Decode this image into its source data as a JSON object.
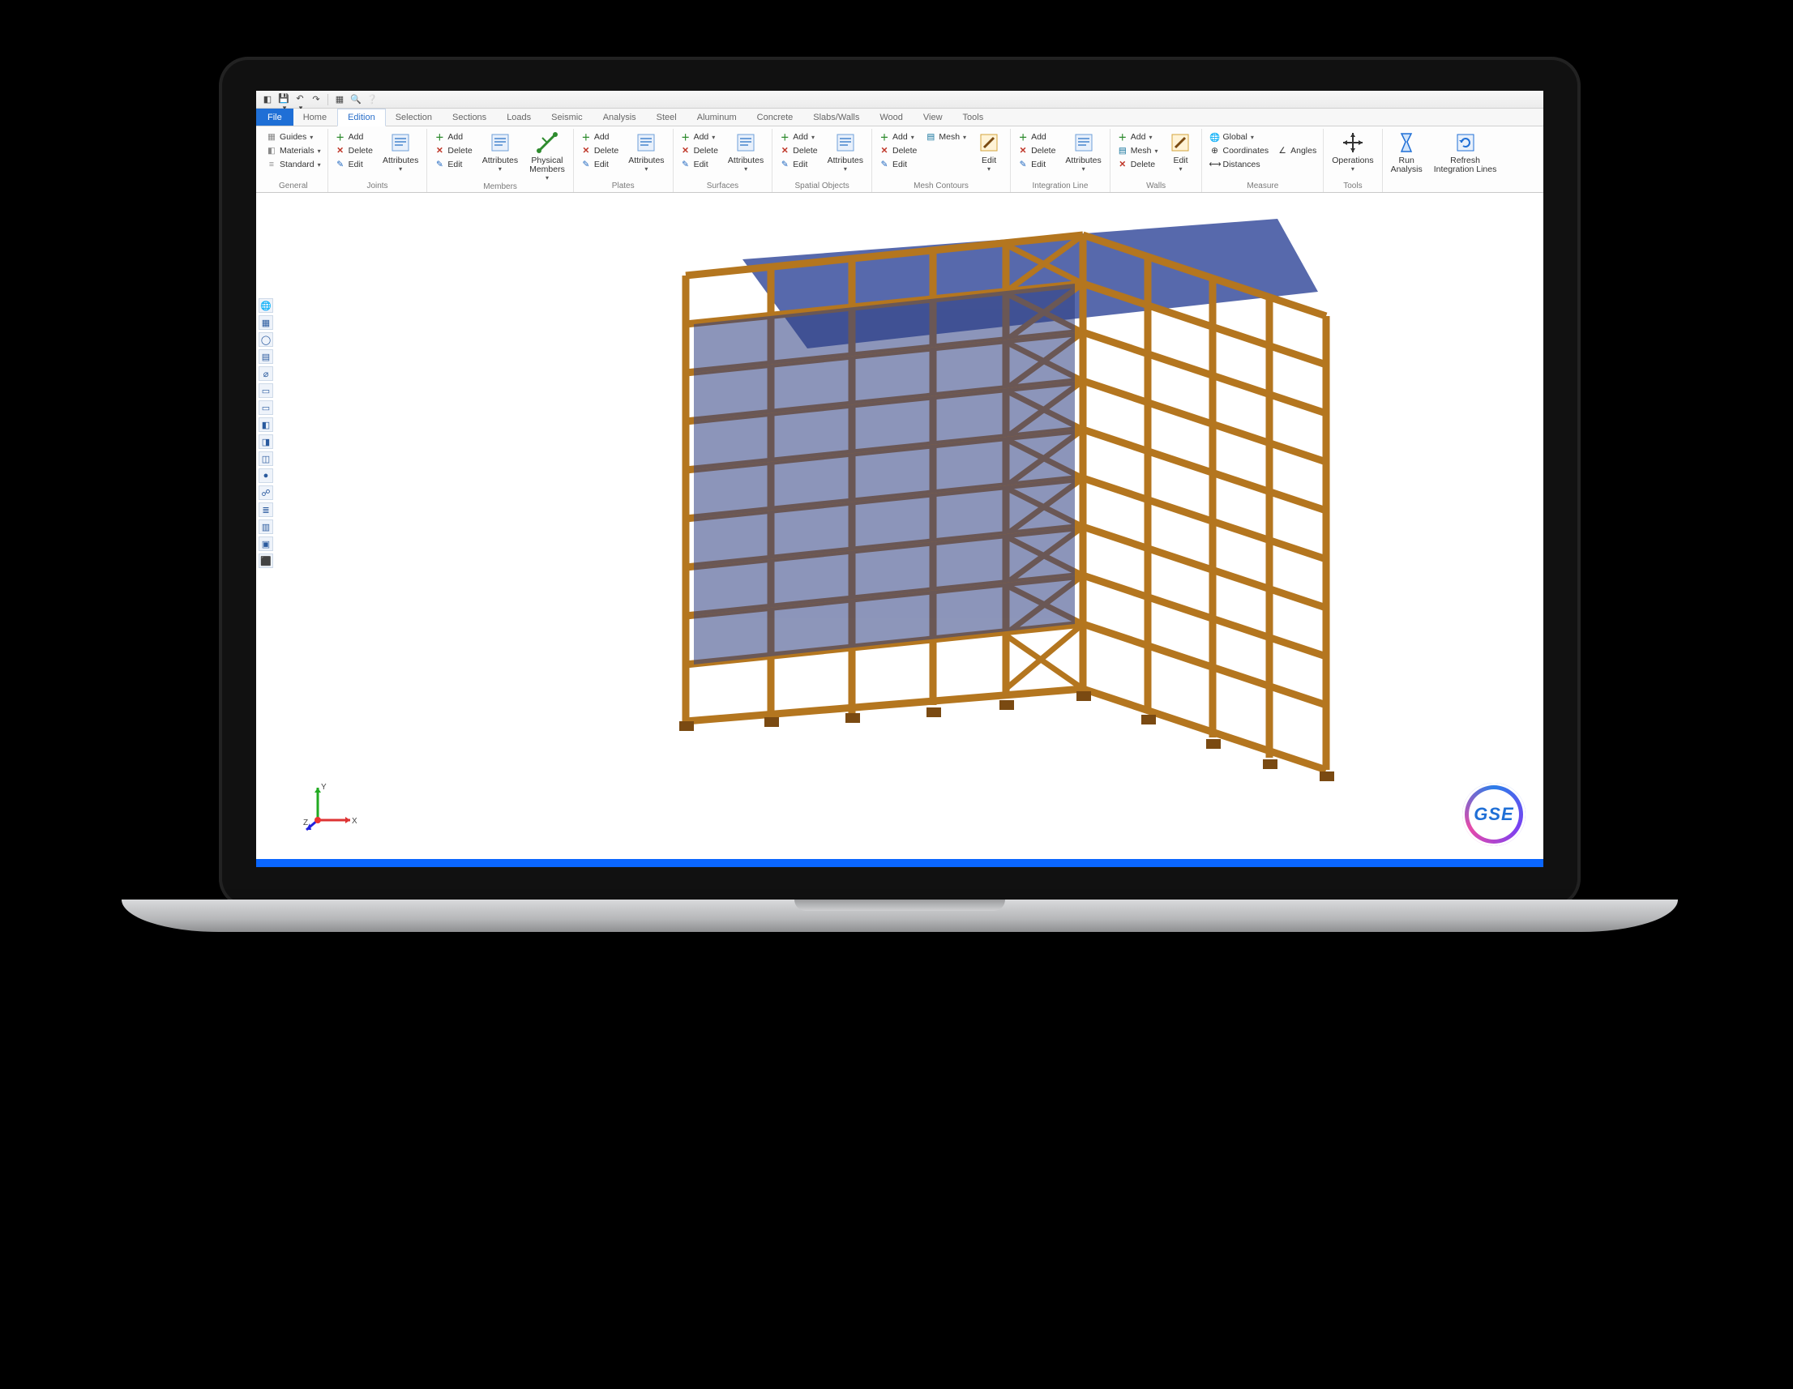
{
  "app": {
    "name": "GSE",
    "logo_text": "GSE"
  },
  "qat": {
    "items": [
      "save",
      "undo",
      "redo",
      "sep",
      "grid",
      "find",
      "help"
    ]
  },
  "tabs": {
    "file": "File",
    "list": [
      "Home",
      "Edition",
      "Selection",
      "Sections",
      "Loads",
      "Seismic",
      "Analysis",
      "Steel",
      "Aluminum",
      "Concrete",
      "Slabs/Walls",
      "Wood",
      "View",
      "Tools"
    ],
    "active_index": 1
  },
  "ribbon": {
    "groups": [
      {
        "name": "General",
        "columns": [
          {
            "buttons": [
              {
                "icon": "grid",
                "label": "Guides",
                "dropdown": true
              },
              {
                "icon": "mat",
                "label": "Materials",
                "dropdown": true
              },
              {
                "icon": "std",
                "label": "Standard",
                "dropdown": true
              }
            ]
          }
        ]
      },
      {
        "name": "Joints",
        "columns": [
          {
            "buttons": [
              {
                "icon": "add",
                "label": "Add"
              },
              {
                "icon": "del",
                "label": "Delete"
              },
              {
                "icon": "edit",
                "label": "Edit"
              }
            ]
          },
          {
            "big": {
              "icon": "attr",
              "label": "Attributes",
              "dropdown": true
            }
          }
        ]
      },
      {
        "name": "Members",
        "columns": [
          {
            "buttons": [
              {
                "icon": "add",
                "label": "Add"
              },
              {
                "icon": "del",
                "label": "Delete"
              },
              {
                "icon": "edit",
                "label": "Edit"
              }
            ]
          },
          {
            "big": {
              "icon": "attr",
              "label": "Attributes",
              "dropdown": true
            }
          },
          {
            "big": {
              "icon": "phys",
              "label": "Physical\nMembers",
              "dropdown": true
            }
          }
        ]
      },
      {
        "name": "Plates",
        "columns": [
          {
            "buttons": [
              {
                "icon": "add",
                "label": "Add"
              },
              {
                "icon": "del",
                "label": "Delete"
              },
              {
                "icon": "edit",
                "label": "Edit"
              }
            ]
          },
          {
            "big": {
              "icon": "attr",
              "label": "Attributes",
              "dropdown": true
            }
          }
        ]
      },
      {
        "name": "Surfaces",
        "columns": [
          {
            "buttons": [
              {
                "icon": "add",
                "label": "Add",
                "dropdown": true
              },
              {
                "icon": "del",
                "label": "Delete"
              },
              {
                "icon": "edit",
                "label": "Edit"
              }
            ]
          },
          {
            "big": {
              "icon": "attr",
              "label": "Attributes",
              "dropdown": true
            }
          }
        ]
      },
      {
        "name": "Spatial Objects",
        "columns": [
          {
            "buttons": [
              {
                "icon": "add",
                "label": "Add",
                "dropdown": true
              },
              {
                "icon": "del",
                "label": "Delete"
              },
              {
                "icon": "edit",
                "label": "Edit"
              }
            ]
          },
          {
            "big": {
              "icon": "attr",
              "label": "Attributes",
              "dropdown": true
            }
          }
        ]
      },
      {
        "name": "Mesh Contours",
        "columns": [
          {
            "buttons": [
              {
                "icon": "add",
                "label": "Add",
                "dropdown": true
              },
              {
                "icon": "del",
                "label": "Delete"
              },
              {
                "icon": "edit",
                "label": "Edit"
              }
            ]
          },
          {
            "buttons": [
              {
                "icon": "mesh",
                "label": "Mesh",
                "dropdown": true
              }
            ]
          },
          {
            "big": {
              "icon": "editbig",
              "label": "Edit",
              "dropdown": true
            }
          }
        ]
      },
      {
        "name": "Integration Line",
        "columns": [
          {
            "buttons": [
              {
                "icon": "add",
                "label": "Add"
              },
              {
                "icon": "del",
                "label": "Delete"
              },
              {
                "icon": "edit",
                "label": "Edit"
              }
            ]
          },
          {
            "big": {
              "icon": "attr",
              "label": "Attributes",
              "dropdown": true
            }
          }
        ]
      },
      {
        "name": "Walls",
        "columns": [
          {
            "buttons": [
              {
                "icon": "add",
                "label": "Add",
                "dropdown": true
              },
              {
                "icon": "mesh",
                "label": "Mesh",
                "dropdown": true
              },
              {
                "icon": "del",
                "label": "Delete"
              }
            ]
          },
          {
            "big": {
              "icon": "editbig",
              "label": "Edit",
              "dropdown": true
            }
          }
        ]
      },
      {
        "name": "Measure",
        "columns": [
          {
            "buttons": [
              {
                "icon": "globe",
                "label": "Global",
                "dropdown": true
              },
              {
                "icon": "coord",
                "label": "Coordinates"
              },
              {
                "icon": "dist",
                "label": "Distances"
              }
            ]
          },
          {
            "buttons": [
              {
                "icon": "blank",
                "label": ""
              },
              {
                "icon": "angle",
                "label": "Angles"
              },
              {
                "icon": "blank",
                "label": ""
              }
            ]
          }
        ]
      },
      {
        "name": "Tools",
        "columns": [
          {
            "big": {
              "icon": "ops",
              "label": "Operations",
              "dropdown": true
            }
          }
        ]
      },
      {
        "name": "",
        "columns": [
          {
            "big": {
              "icon": "run",
              "label": "Run\nAnalysis"
            }
          },
          {
            "big": {
              "icon": "refresh",
              "label": "Refresh\nIntegration Lines"
            }
          }
        ]
      }
    ]
  },
  "vtoolbar": [
    "globe",
    "grid",
    "circle",
    "layers",
    "dim",
    "box",
    "box",
    "mat",
    "mat2",
    "cube",
    "ball",
    "link",
    "layers2",
    "page",
    "sel",
    "stop"
  ],
  "triad": {
    "x": "X",
    "y": "Y",
    "z": "Z"
  }
}
